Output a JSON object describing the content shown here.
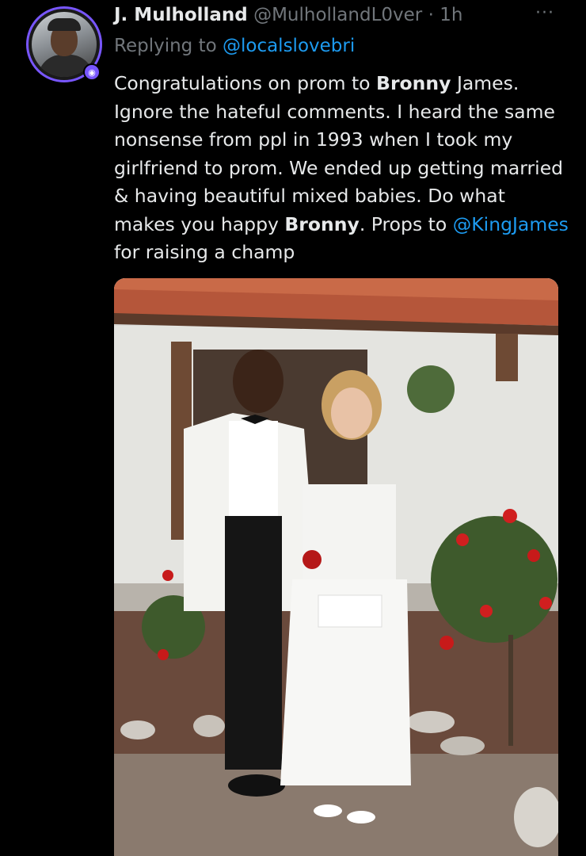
{
  "tweet": {
    "author_name": "J. Mulholland",
    "author_handle": "@MulhollandL0ver",
    "separator": "·",
    "time": "1h",
    "reply_prefix": "Replying to",
    "reply_to": "@localslovebri",
    "body": {
      "t1": "Congratulations on prom to ",
      "b1": "Bronny",
      "t2": " James. Ignore the hateful comments. I heard the same nonsense from ppl in 1993 when I took my girlfriend to prom. We ended up getting married & having beautiful mixed babies. Do what makes you happy ",
      "b2": "Bronny",
      "t3": ". Props to ",
      "mention": "@KingJames",
      "t4": " for raising a champ"
    },
    "more_icon": "···"
  },
  "colors": {
    "background": "#000000",
    "text": "#e7e9ea",
    "muted": "#71767b",
    "link": "#1d9bf0",
    "avatar_ring": "#7856ff"
  }
}
